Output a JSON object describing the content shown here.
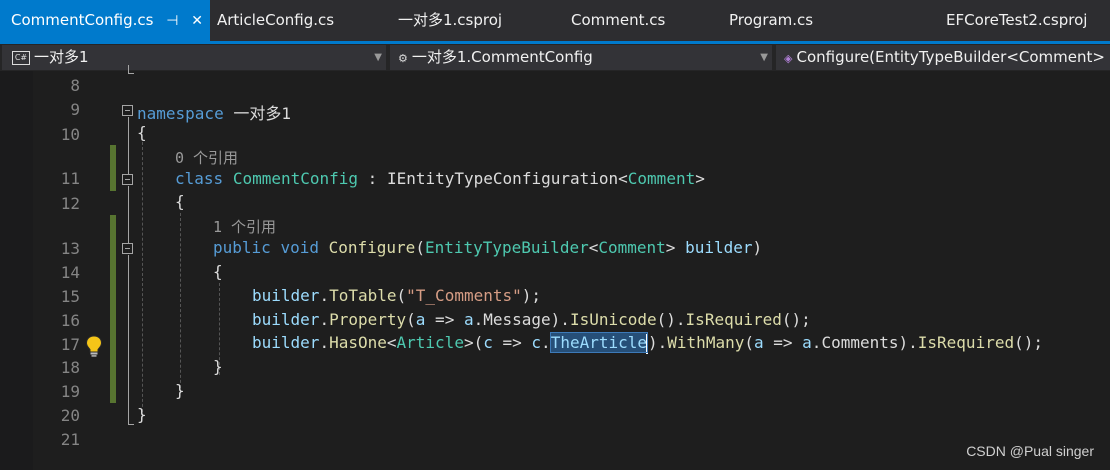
{
  "tabs": [
    {
      "label": "CommentConfig.cs",
      "active": true
    },
    {
      "label": "ArticleConfig.cs",
      "active": false
    },
    {
      "label": "一对多1.csproj",
      "active": false
    },
    {
      "label": "Comment.cs",
      "active": false
    },
    {
      "label": "Program.cs",
      "active": false
    },
    {
      "label": "EFCoreTest2.csproj",
      "active": false
    }
  ],
  "tab_icons": {
    "pin": "pin-icon",
    "close": "close-icon"
  },
  "navbar": {
    "project": "一对多1",
    "type": "一对多1.CommentConfig",
    "member": "Configure(EntityTypeBuilder<Comment>"
  },
  "line_numbers": [
    "8",
    "9",
    "10",
    "11",
    "12",
    "13",
    "14",
    "15",
    "16",
    "17",
    "18",
    "19",
    "20",
    "21"
  ],
  "code": {
    "l9": {
      "kw": "namespace",
      "name": " 一对多1"
    },
    "l10": "{",
    "ref0": "0 个引用",
    "l11": {
      "kw": "class",
      "name": "CommentConfig",
      "colon": " : ",
      "iface": "IEntityTypeConfiguration",
      "lt": "<",
      "arg": "Comment",
      "gt": ">"
    },
    "l12": "{",
    "ref1": "1 个引用",
    "l13": {
      "kw1": "public",
      "kw2": "void",
      "fn": "Configure",
      "p1": "(",
      "t1": "EntityTypeBuilder",
      "lt": "<",
      "t2": "Comment",
      "gt": ">",
      "param": "builder",
      "p2": ")"
    },
    "l14": "{",
    "l15": {
      "obj": "builder",
      "dot": ".",
      "fn": "ToTable",
      "p1": "(",
      "str": "\"T_Comments\"",
      "p2": ");"
    },
    "l16": {
      "obj": "builder",
      "dot1": ".",
      "fn1": "Property",
      "p1": "(",
      "a1": "a",
      "arrow": " => ",
      "a2": "a",
      "dot2": ".",
      "prop": "Message",
      "p2": ").",
      "fn2": "IsUnicode",
      "p3": "().",
      "fn3": "IsRequired",
      "p4": "();"
    },
    "l17": {
      "obj": "builder",
      "dot1": ".",
      "fn1": "HasOne",
      "lt": "<",
      "ty": "Article",
      "gt": ">",
      "p1": "(",
      "c1": "c",
      "arrow1": " => ",
      "c2": "c",
      "dot2": ".",
      "sel": "TheArticle",
      "p2": ").",
      "fn2": "WithMany",
      "p3": "(",
      "a1": "a",
      "arrow2": " => ",
      "a2": "a",
      "dot3": ".",
      "prop": "Comments",
      "p4": ").",
      "fn3": "IsRequired",
      "p5": "();"
    },
    "l18": "}",
    "l19": "}",
    "l20": "}"
  },
  "colors": {
    "tab_active": "#007acc",
    "keyword": "#569cd6",
    "type": "#4ec9b0",
    "method": "#dcdcaa",
    "variable": "#9cdcfe",
    "string": "#d69d85",
    "change_bar": "#577430"
  },
  "icons": {
    "lightbulb": "lightbulb-icon",
    "csharp": "csharp-file-icon",
    "class": "class-icon",
    "method": "method-icon"
  },
  "watermark": "CSDN @Pual singer"
}
